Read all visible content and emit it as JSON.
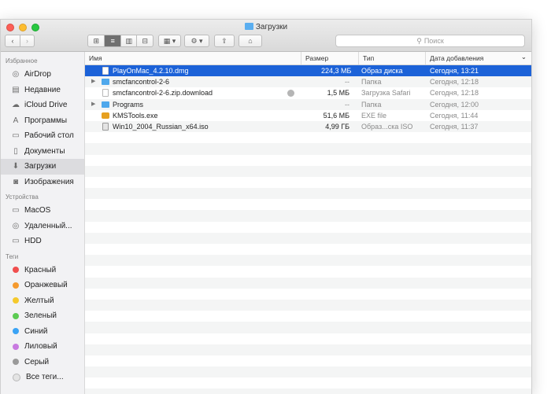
{
  "window": {
    "title": "Загрузки"
  },
  "toolbar": {
    "back_icon": "chevron-left",
    "forward_icon": "chevron-right",
    "view_icons": "⊞",
    "view_list": "≡",
    "view_columns": "▥",
    "view_coverflow": "⊟",
    "arrange_label": "▦ ▾",
    "action_label": "⚙ ▾",
    "share_label": "⇪",
    "tag_label": "⌂",
    "search_placeholder": "Поиск",
    "search_icon": "⚲"
  },
  "sidebar": {
    "favorites_header": "Избранное",
    "favorites": [
      {
        "label": "AirDrop",
        "icon": "airdrop-icon",
        "glyph": "◎"
      },
      {
        "label": "Недавние",
        "icon": "recents-icon",
        "glyph": "▤"
      },
      {
        "label": "iCloud Drive",
        "icon": "cloud-icon",
        "glyph": "☁"
      },
      {
        "label": "Программы",
        "icon": "applications-icon",
        "glyph": "A"
      },
      {
        "label": "Рабочий стол",
        "icon": "desktop-icon",
        "glyph": "▭"
      },
      {
        "label": "Документы",
        "icon": "documents-icon",
        "glyph": "▯"
      },
      {
        "label": "Загрузки",
        "icon": "downloads-icon",
        "glyph": "⬇"
      },
      {
        "label": "Изображения",
        "icon": "pictures-icon",
        "glyph": "◙"
      }
    ],
    "devices_header": "Устройства",
    "devices": [
      {
        "label": "MacOS",
        "icon": "disk-icon",
        "glyph": "▭"
      },
      {
        "label": "Удаленный...",
        "icon": "remote-disc-icon",
        "glyph": "◎"
      },
      {
        "label": "HDD",
        "icon": "disk-icon",
        "glyph": "▭"
      }
    ],
    "tags_header": "Теги",
    "tags": [
      {
        "label": "Красный",
        "color": "#f04e4e"
      },
      {
        "label": "Оранжевый",
        "color": "#f59a2f"
      },
      {
        "label": "Желтый",
        "color": "#f5c92c"
      },
      {
        "label": "Зеленый",
        "color": "#5ccb53"
      },
      {
        "label": "Синий",
        "color": "#3ba3f5"
      },
      {
        "label": "Лиловый",
        "color": "#c87ae0"
      },
      {
        "label": "Серый",
        "color": "#9a9a9a"
      },
      {
        "label": "Все теги...",
        "color": "#e4e4e4"
      }
    ]
  },
  "columns": {
    "name": "Имя",
    "size": "Размер",
    "kind": "Тип",
    "date": "Дата добавления",
    "sort_indicator": "⌄"
  },
  "files": [
    {
      "name": "PlayOnMac_4.2.10.dmg",
      "size": "224,3 МБ",
      "kind": "Образ диска",
      "date": "Сегодня, 13:21",
      "selected": true,
      "folder": false,
      "icon": "dmg"
    },
    {
      "name": "smcfancontrol-2-6",
      "size": "--",
      "kind": "Папка",
      "date": "Сегодня, 12:18",
      "selected": false,
      "folder": true,
      "icon": "folder"
    },
    {
      "name": "smcfancontrol-2-6.zip.download",
      "size": "1,5 МБ",
      "kind": "Загрузка Safari",
      "date": "Сегодня, 12:18",
      "selected": false,
      "folder": false,
      "icon": "file",
      "downloading": true
    },
    {
      "name": "Programs",
      "size": "--",
      "kind": "Папка",
      "date": "Сегодня, 12:00",
      "selected": false,
      "folder": true,
      "icon": "folder"
    },
    {
      "name": "KMSTools.exe",
      "size": "51,6 МБ",
      "kind": "EXE file",
      "date": "Сегодня, 11:44",
      "selected": false,
      "folder": false,
      "icon": "exe"
    },
    {
      "name": "Win10_2004_Russian_x64.iso",
      "size": "4,99 ГБ",
      "kind": "Образ...ска ISO",
      "date": "Сегодня, 11:37",
      "selected": false,
      "folder": false,
      "icon": "iso"
    }
  ],
  "expand_glyph": "▶"
}
